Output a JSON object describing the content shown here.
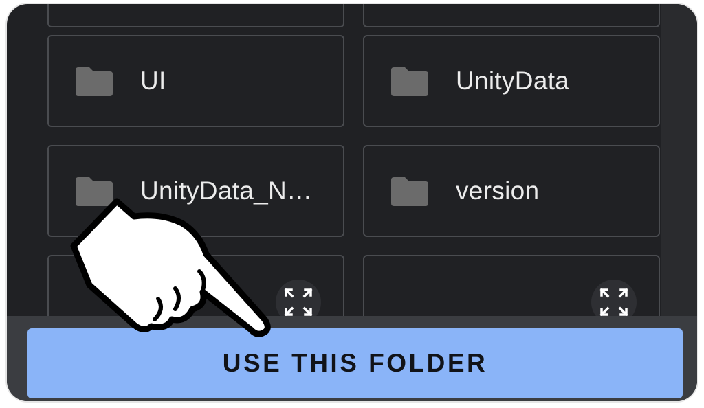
{
  "folders": [
    {
      "name": "UI"
    },
    {
      "name": "UnityData"
    },
    {
      "name": "UnityData_N…"
    },
    {
      "name": "version"
    }
  ],
  "actions": {
    "use_folder_label": "USE THIS FOLDER"
  },
  "colors": {
    "background": "#202124",
    "tile_border": "#4a4c50",
    "folder_icon": "#6b6b6b",
    "button": "#8ab4f8",
    "button_text": "#111318"
  },
  "icons": {
    "folder": "folder-icon",
    "expand": "expand-icon",
    "pointer": "pointing-hand-icon"
  }
}
